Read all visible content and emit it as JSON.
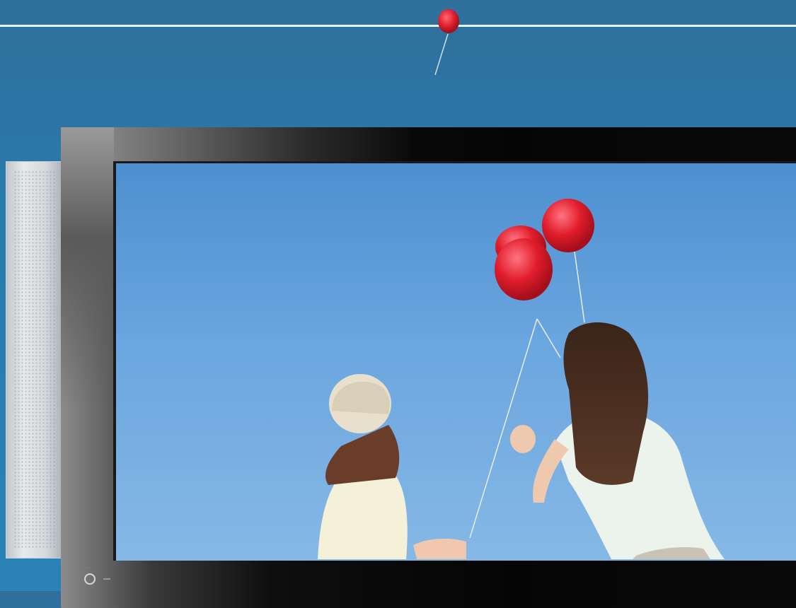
{
  "scene": {
    "description_colors": {
      "background": "#2a79aa",
      "sky": "#6aa6df",
      "balloon": "#e02030",
      "tv_bezel": "#0a0a0a",
      "speaker": "#d4d9dc"
    },
    "icons": [
      "power-icon"
    ]
  }
}
